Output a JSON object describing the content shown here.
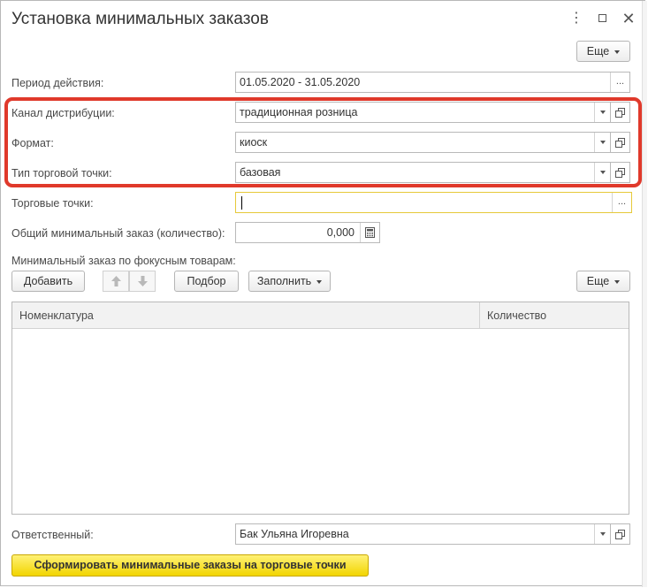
{
  "window": {
    "title": "Установка минимальных заказов",
    "menu_icon": "⋮",
    "close_icon": "✕"
  },
  "more_label": "Еще",
  "period": {
    "label": "Период действия:",
    "value": "01.05.2020 - 31.05.2020"
  },
  "channel": {
    "label": "Канал дистрибуции:",
    "value": "традиционная розница"
  },
  "format": {
    "label": "Формат:",
    "value": "киоск"
  },
  "outlet_type": {
    "label": "Тип торговой точки:",
    "value": "базовая"
  },
  "outlets": {
    "label": "Торговые точки:",
    "value": ""
  },
  "total_min": {
    "label": "Общий минимальный заказ (количество):",
    "value": "0,000"
  },
  "focus": {
    "label": "Минимальный заказ по фокусным товарам:",
    "add_label": "Добавить",
    "pick_label": "Подбор",
    "fill_label": "Заполнить",
    "more_label": "Еще"
  },
  "table": {
    "columns": [
      "Номенклатура",
      "Количество"
    ],
    "rows": []
  },
  "responsible": {
    "label": "Ответственный:",
    "value": "Бак Ульяна Игоревна"
  },
  "generate_label": "Сформировать минимальные заказы на торговые точки",
  "colors": {
    "highlight": "#e0392b",
    "primary_button": "#f2d500",
    "focus_border": "#e6c93a"
  }
}
